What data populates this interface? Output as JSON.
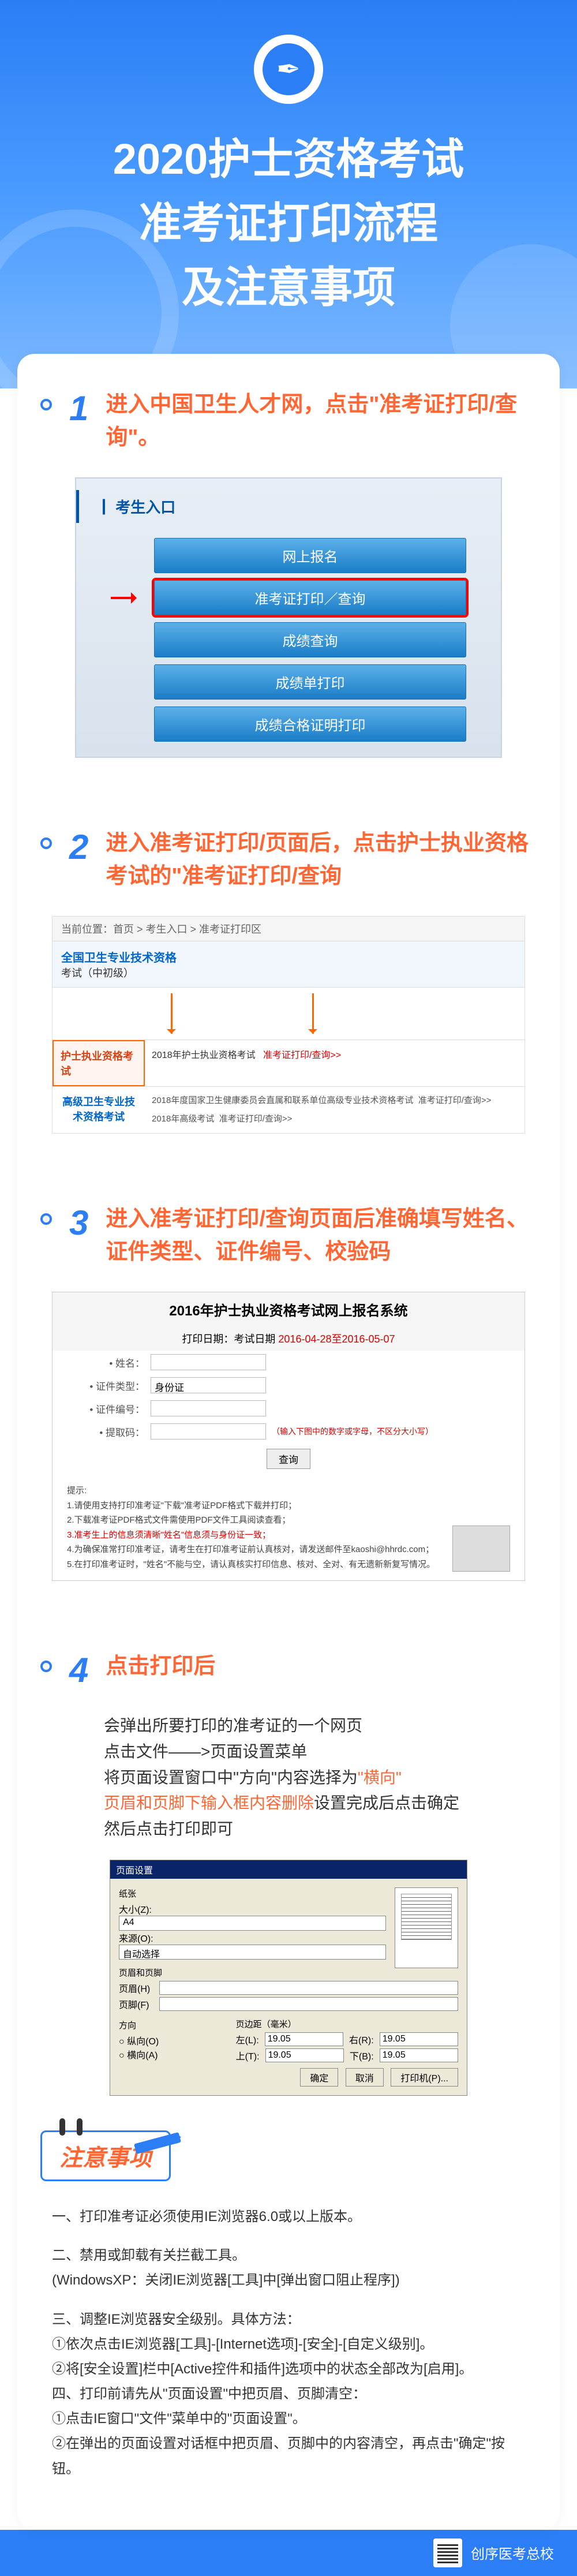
{
  "header": {
    "title_line1": "2020护士资格考试",
    "title_line2": "准考证打印流程",
    "title_line3": "及注意事项"
  },
  "steps": [
    {
      "num": "1",
      "title": "进入中国卫生人才网，点击\"准考证打印/查询\"。",
      "shot1": {
        "entry": "┃ 考生入口",
        "btns": [
          "网上报名",
          "准考证打印／查询",
          "成绩查询",
          "成绩单打印",
          "成绩合格证明打印"
        ]
      }
    },
    {
      "num": "2",
      "title": "进入准考证打印/页面后，点击护士执业资格考试的\"准考证打印/查询",
      "shot2": {
        "bc": "当前位置：首页 > 考生入口 > 准考证打印区",
        "banner_t1": "全国卫生专业技术资格",
        "banner_t2": "考试（中初级）",
        "row1_label": "护士执业资格考试",
        "row1_body_a": "2018年护士执业资格考试",
        "row1_body_b": "准考证打印/查询>>",
        "row2_label": "高级卫生专业技术资格考试",
        "row2_body_a": "2018年度国家卫生健康委员会直属和联系单位高级专业技术资格考试",
        "row2_body_b": "准考证打印/查询>>",
        "row3_body_a": "2018年高级考试",
        "row3_body_b": "准考证打印/查询>>"
      }
    },
    {
      "num": "3",
      "title": "进入准考证打印/查询页面后准确填写姓名、证件类型、证件编号、校验码",
      "shot3": {
        "title": "2016年护士执业资格考试网上报名系统",
        "sub_a": "打印日期：考试日期",
        "sub_b": "2016-04-28至2016-05-07",
        "f_name": "• 姓名：",
        "f_type": "• 证件类型：",
        "f_type_v": "身份证",
        "f_id": "• 证件编号：",
        "f_code": "• 提取码：",
        "f_code_hint": "（输入下图中的数字或字母，不区分大小写）",
        "btn": "查询",
        "tips_title": "提示:",
        "tips": [
          "1.请使用支持打印准考证\"下载\"准考证PDF格式下载并打印；",
          "2.下载准考证PDF格式文件需使用PDF文件工具阅读查看；",
          "3.准考生上的信息须清晰\"姓名\"信息须与身份证一致；",
          "4.为确保准常打印准考证，请考生在打印准考证前认真核对，请发送邮件至kaoshi@hhrdc.com；",
          "5.在打印准考证时，\"姓名\"不能与空，请认真核实打印信息、核对、全对、有无遗新新复写情况。"
        ]
      }
    },
    {
      "num": "4",
      "title": "点击打印后",
      "sub_lines": [
        {
          "t": "会弹出所要打印的准考证的一个网页",
          "hl": false
        },
        {
          "t": "点击文件——>页面设置菜单",
          "hl": false
        },
        {
          "t": "将页面设置窗口中\"方向\"内容选择为",
          "hl": false
        },
        {
          "t": "\"横向\"",
          "hl": true
        },
        {
          "t": "页眉和页脚下输入框内容删除",
          "hl": true
        },
        {
          "t": "设置完成后点击确定",
          "hl": false
        },
        {
          "t": "然后点击打印即可",
          "hl": false
        }
      ],
      "shot4": {
        "title": "页面设置",
        "g_paper": "纸张",
        "g_size": "大小(Z):",
        "g_size_v": "A4",
        "g_src": "来源(O):",
        "g_src_v": "自动选择",
        "g_hf": "页眉和页脚",
        "g_header": "页眉(H)",
        "g_footer": "页脚(F)",
        "g_orient": "方向",
        "g_portrait": "纵向(O)",
        "g_landscape": "横向(A)",
        "g_margin": "页边距（毫米）",
        "g_left": "左(L):",
        "g_left_v": "19.05",
        "g_right": "右(R):",
        "g_right_v": "19.05",
        "g_top": "上(T):",
        "g_top_v": "19.05",
        "g_bottom": "下(B):",
        "g_bottom_v": "19.05",
        "btn_ok": "确定",
        "btn_cancel": "取消",
        "btn_print": "打印机(P)..."
      }
    }
  ],
  "notes": {
    "badge": "注意事项",
    "items": [
      "一、打印准考证必须使用IE浏览器6.0或以上版本。",
      "二、禁用或卸载有关拦截工具。\n(WindowsXP：关闭IE浏览器[工具]中[弹出窗口阻止程序])",
      "三、调整IE浏览器安全级别。具体方法：\n①依次点击IE浏览器[工具]-[Internet选项]-[安全]-[自定义级别]。\n②将[安全设置]栏中[Active控件和插件]选项中的状态全部改为[启用]。\n四、打印前请先从\"页面设置\"中把页眉、页脚清空：\n①点击IE窗口\"文件\"菜单中的\"页面设置\"。\n②在弹出的页面设置对话框中把页眉、页脚中的内容清空，再点击\"确定\"按钮。"
    ]
  },
  "footer": {
    "org": "创序医考总校"
  }
}
